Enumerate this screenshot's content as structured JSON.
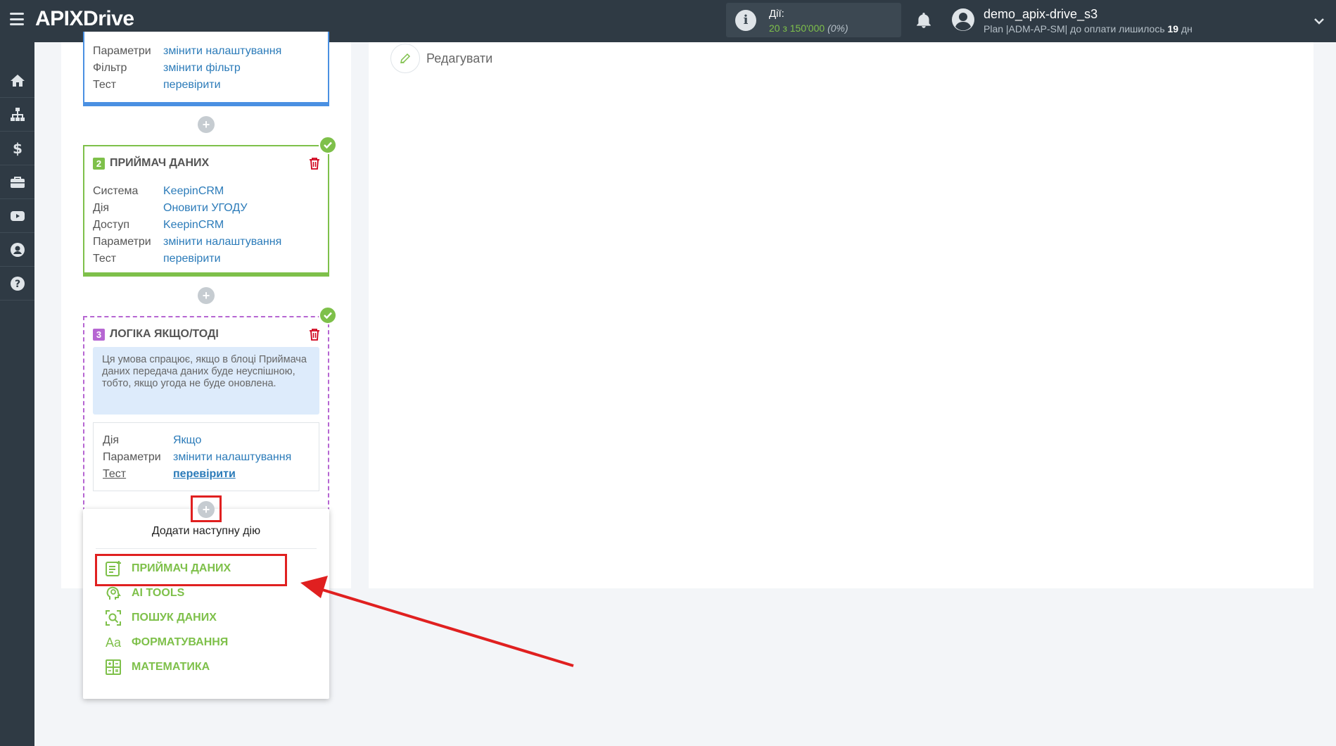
{
  "header": {
    "logo_main": "APIX",
    "logo_x": "",
    "logo_suffix": "Drive",
    "actions_label": "Дії:",
    "actions_count": "20 з 150'000",
    "actions_percent": "(0%)",
    "user_name": "demo_apix-drive_s3",
    "user_plan_prefix": "Plan |ADM-AP-SM| до оплати лишилось ",
    "user_plan_days": "19",
    "user_plan_suffix": " дн"
  },
  "sidebar": {
    "items": [
      {
        "name": "home",
        "icon": "home-icon"
      },
      {
        "name": "structure",
        "icon": "sitemap-icon"
      },
      {
        "name": "billing",
        "icon": "dollar-icon"
      },
      {
        "name": "tools",
        "icon": "briefcase-icon"
      },
      {
        "name": "video",
        "icon": "youtube-icon"
      },
      {
        "name": "profile",
        "icon": "user-icon"
      },
      {
        "name": "help",
        "icon": "question-icon"
      }
    ]
  },
  "right_panel": {
    "edit_label": "Редагувати"
  },
  "block1": {
    "rows": [
      {
        "key": "Параметри",
        "value": "змінити налаштування"
      },
      {
        "key": "Фільтр",
        "value": "змінити фільтр"
      },
      {
        "key": "Тест",
        "value": "перевірити"
      }
    ]
  },
  "block2": {
    "number": "2",
    "title": "ПРИЙМАЧ ДАНИХ",
    "rows": [
      {
        "key": "Система",
        "value": "KeepinCRM"
      },
      {
        "key": "Дія",
        "value": "Оновити УГОДУ"
      },
      {
        "key": "Доступ",
        "value": "KeepinCRM"
      },
      {
        "key": "Параметри",
        "value": "змінити налаштування"
      },
      {
        "key": "Тест",
        "value": "перевірити"
      }
    ]
  },
  "block3": {
    "number": "3",
    "title": "ЛОГІКА ЯКЩО/ТОДІ",
    "note": "Ця умова спрацює, якщо в блоці Приймача даних передача даних буде неуспішною, тобто, якщо угода не буде оновлена.",
    "rows": [
      {
        "key": "Дія",
        "value": "Якщо"
      },
      {
        "key": "Параметри",
        "value": "змінити налаштування"
      },
      {
        "key": "Тест",
        "value": "перевірити"
      }
    ]
  },
  "dropdown": {
    "title": "Додати наступну дію",
    "items": [
      {
        "label": "ПРИЙМАЧ ДАНИХ",
        "icon": "receiver-icon"
      },
      {
        "label": "AI TOOLS",
        "icon": "ai-head-icon"
      },
      {
        "label": "ПОШУК ДАНИХ",
        "icon": "search-data-icon"
      },
      {
        "label": "ФОРМАТУВАННЯ",
        "icon": "format-icon",
        "glyph": "Aa"
      },
      {
        "label": "МАТЕМАТИКА",
        "icon": "calculator-icon"
      }
    ]
  },
  "colors": {
    "topbar": "#2f3a44",
    "accent_green": "#7ec04a",
    "link_blue": "#2b7bb9",
    "block1_border": "#4a90e2",
    "block3_border": "#b666d2",
    "highlight_red": "#e02020"
  }
}
